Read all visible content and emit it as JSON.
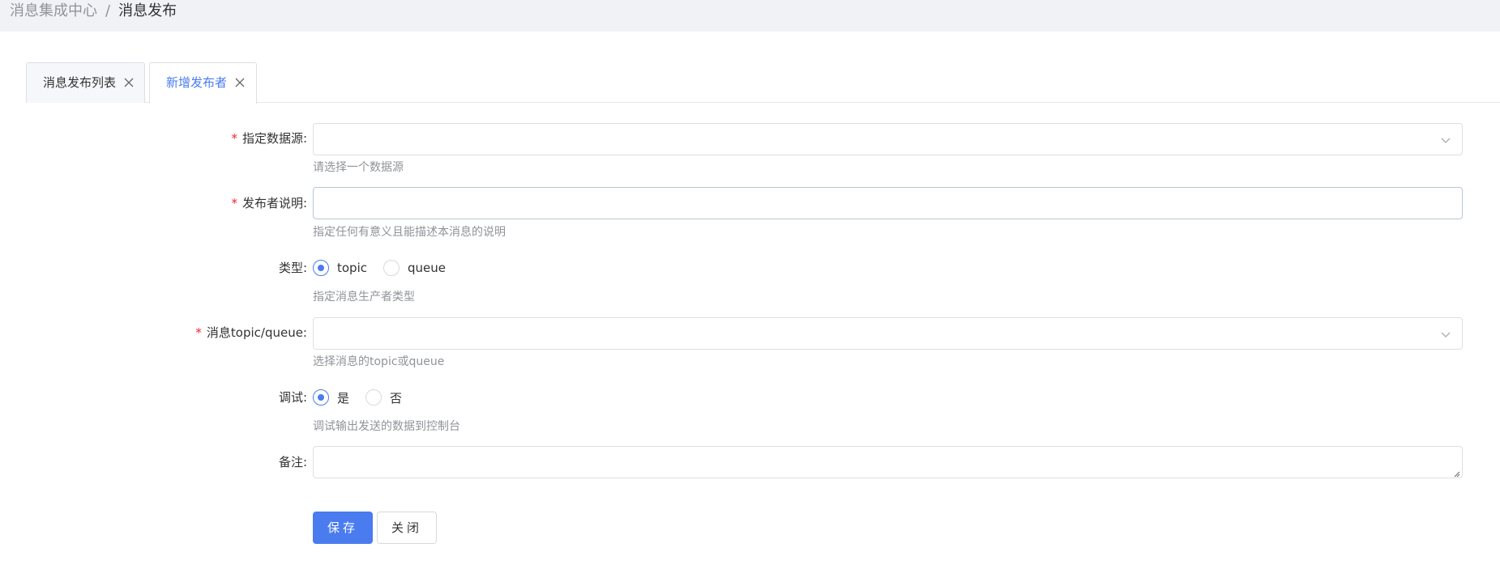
{
  "breadcrumb": {
    "parent": "消息集成中心",
    "separator": "/",
    "current": "消息发布"
  },
  "tabs": [
    {
      "label": "消息发布列表",
      "active": false
    },
    {
      "label": "新增发布者",
      "active": true
    }
  ],
  "form": {
    "datasource": {
      "label": "指定数据源:",
      "required": true,
      "value": "",
      "hint": "请选择一个数据源"
    },
    "description": {
      "label": "发布者说明:",
      "required": true,
      "value": "",
      "hint": "指定任何有意义且能描述本消息的说明"
    },
    "type": {
      "label": "类型:",
      "options": [
        "topic",
        "queue"
      ],
      "selected": "topic",
      "hint": "指定消息生产者类型"
    },
    "destination": {
      "label": "消息topic/queue:",
      "required": true,
      "value": "",
      "hint": "选择消息的topic或queue"
    },
    "debug": {
      "label": "调试:",
      "options": [
        "是",
        "否"
      ],
      "selected": "是",
      "hint": "调试输出发送的数据到控制台"
    },
    "remark": {
      "label": "备注:",
      "value": ""
    }
  },
  "buttons": {
    "save": "保存",
    "close": "关闭"
  },
  "colors": {
    "primary": "#4a7cf0",
    "required": "#f5222d",
    "hint": "#909399",
    "topbar_bg": "#f0f2f5"
  }
}
